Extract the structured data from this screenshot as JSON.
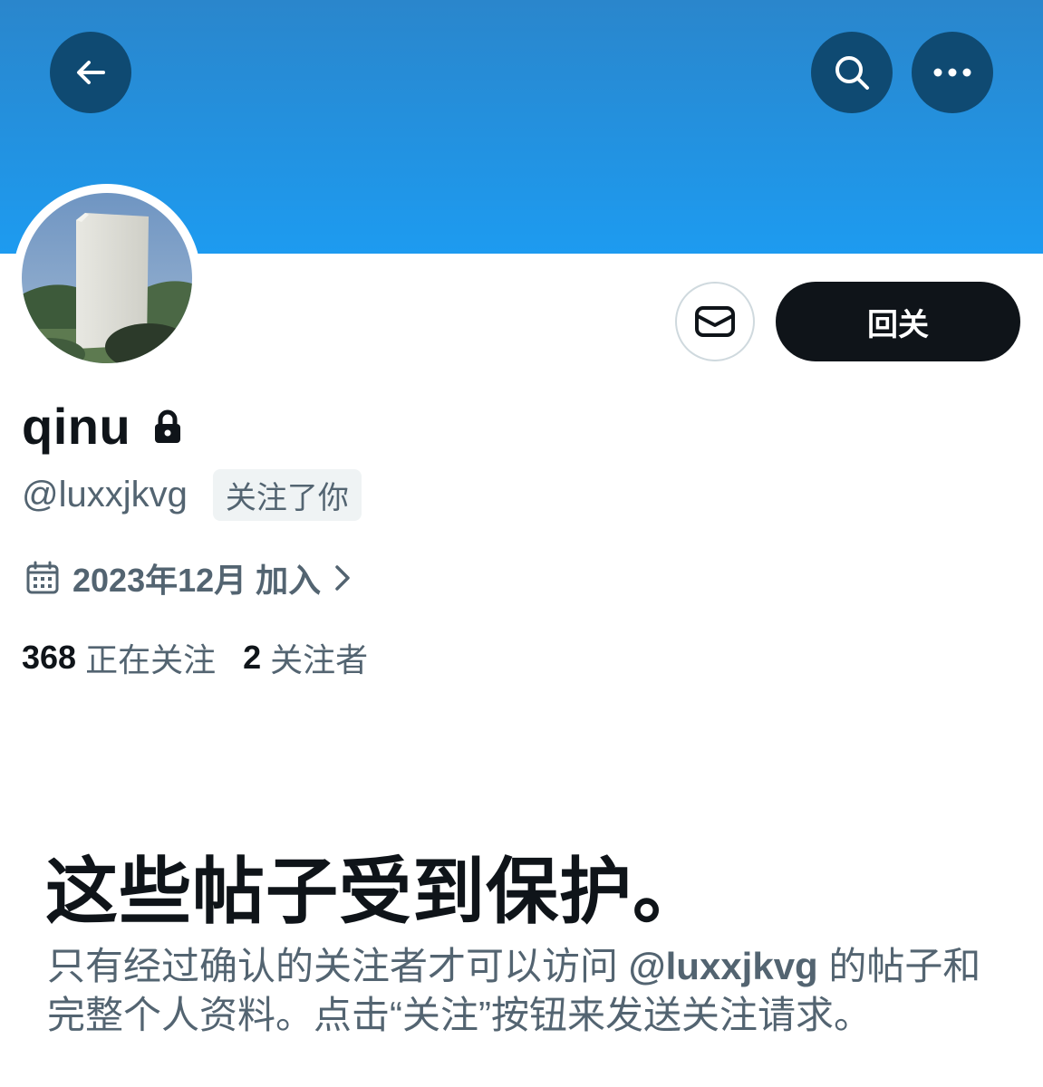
{
  "header": {
    "back_icon": "arrow-left-icon",
    "search_icon": "search-icon",
    "more_icon": "more-horizontal-icon",
    "banner_color": "#1d9bf0",
    "button_color": "#0f4a72"
  },
  "profile": {
    "display_name": "qinu",
    "lock_icon": "lock-icon",
    "handle": "@luxxjkvg",
    "follows_you_badge": "关注了你",
    "joined": "2023年12月 加入",
    "calendar_icon": "calendar-icon"
  },
  "actions": {
    "message_icon": "envelope-icon",
    "follow_back_label": "回关"
  },
  "stats": {
    "following_count": "368",
    "following_label": "正在关注",
    "followers_count": "2",
    "followers_label": "关注者"
  },
  "protected": {
    "title": "这些帖子受到保护。",
    "desc_before": "只有经过确认的关注者才可以访问 ",
    "desc_handle": "@luxxjkvg",
    "desc_after": " 的帖子和完整个人资料。点击“关注”按钮来发送关注请求。"
  }
}
